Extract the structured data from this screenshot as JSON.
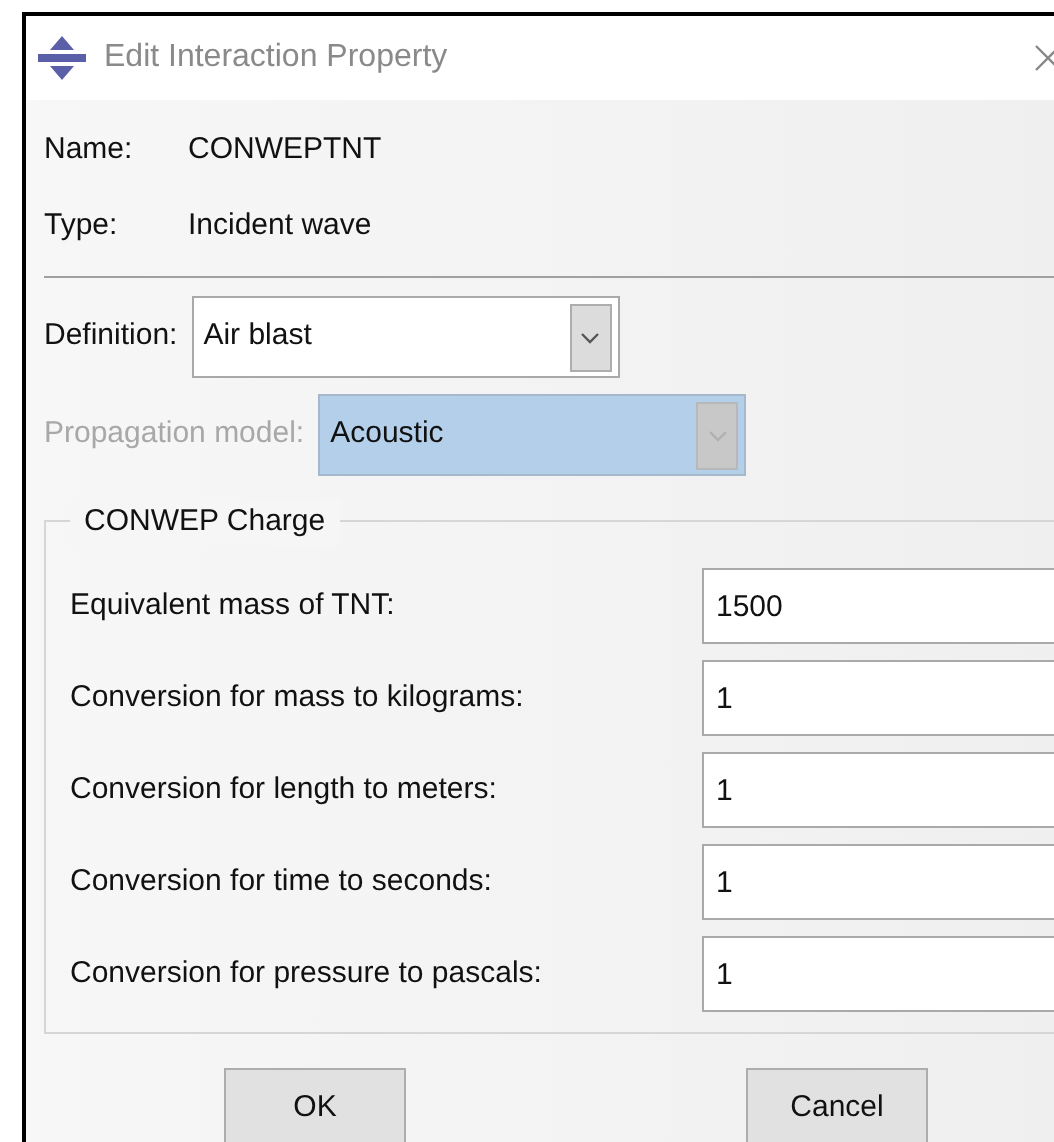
{
  "window": {
    "title": "Edit Interaction Property"
  },
  "info": [
    {
      "label": "Name:",
      "value": "CONWEPTNT"
    },
    {
      "label": "Type:",
      "value": "Incident wave"
    }
  ],
  "selects": [
    {
      "label": "Definition:",
      "value": "Air blast",
      "disabled": false
    },
    {
      "label": "Propagation model:",
      "value": "Acoustic",
      "disabled": true
    }
  ],
  "group": {
    "title": "CONWEP Charge",
    "fields": [
      {
        "label": "Equivalent mass of TNT:",
        "value": "1500"
      },
      {
        "label": "Conversion for mass to kilograms:",
        "value": "1"
      },
      {
        "label": "Conversion for length to meters:",
        "value": "1"
      },
      {
        "label": "Conversion for time to seconds:",
        "value": "1"
      },
      {
        "label": "Conversion for pressure to pascals:",
        "value": "1"
      }
    ]
  },
  "buttons": [
    "OK",
    "Cancel"
  ]
}
